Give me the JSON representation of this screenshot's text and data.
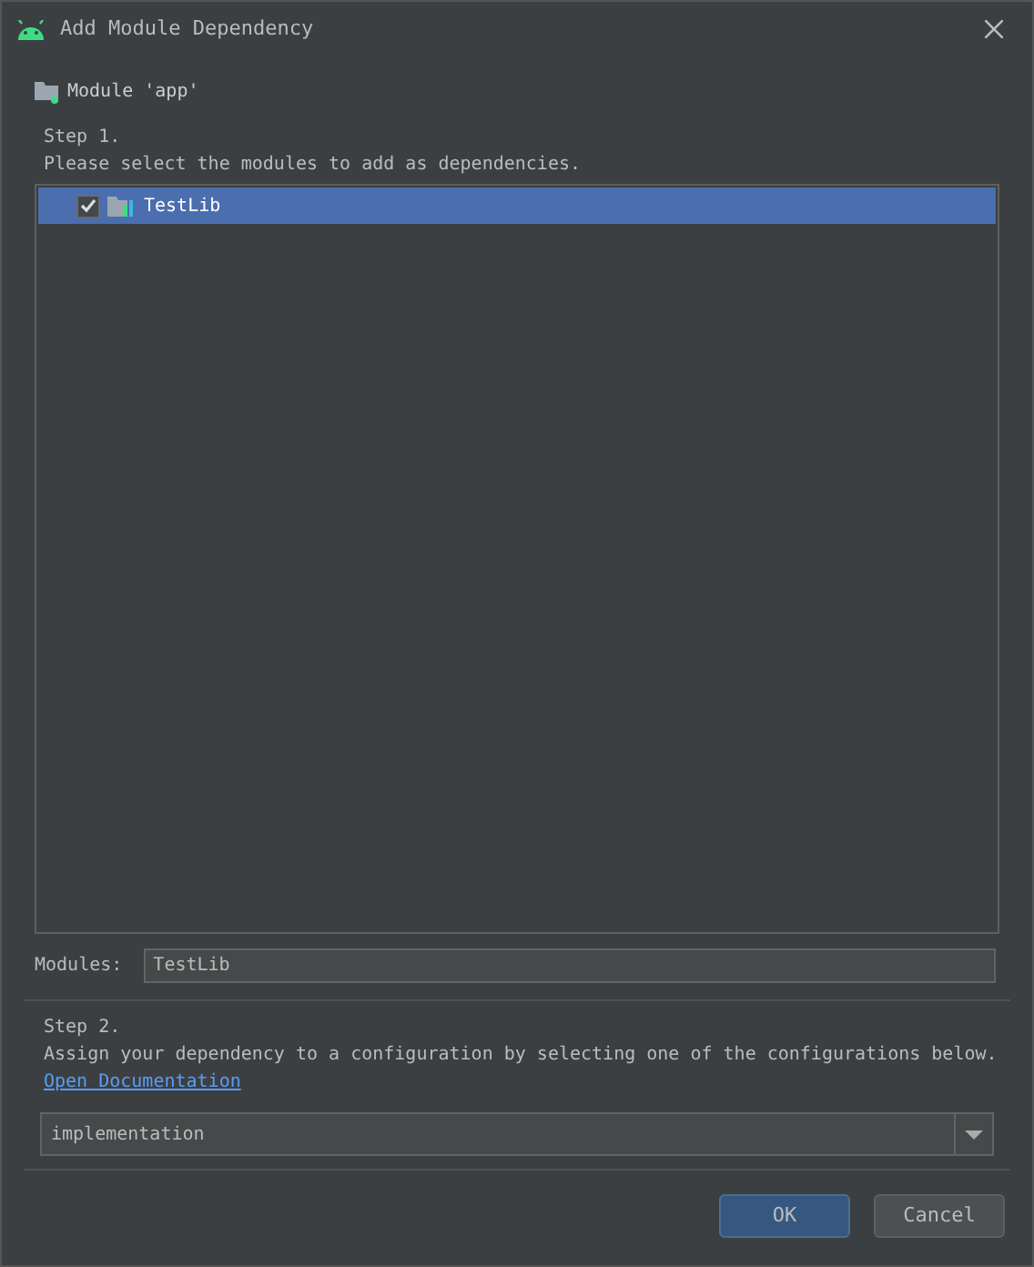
{
  "window": {
    "title": "Add Module Dependency"
  },
  "module_header": "Module 'app'",
  "step1": {
    "title": "Step 1.",
    "description": "Please select the modules to add as dependencies."
  },
  "modules_list": [
    {
      "label": "TestLib",
      "checked": true,
      "selected": true
    }
  ],
  "modules_field": {
    "label": "Modules:",
    "value": "TestLib"
  },
  "step2": {
    "title": "Step 2.",
    "description": "Assign your dependency to a configuration by selecting one of the configurations below.",
    "link": "Open Documentation"
  },
  "configuration": {
    "value": "implementation"
  },
  "buttons": [
    {
      "label": "OK",
      "kind": "primary"
    },
    {
      "label": "Cancel",
      "kind": "secondary"
    }
  ]
}
